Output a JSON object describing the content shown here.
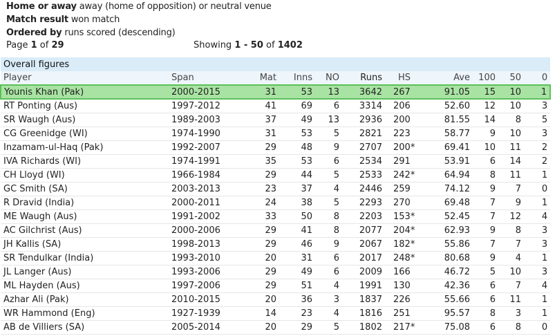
{
  "filters": [
    {
      "label": "Home or away",
      "value": "away (home of opposition) or neutral venue"
    },
    {
      "label": "Match result",
      "value": "won match"
    },
    {
      "label": "Ordered by",
      "value": "runs scored (descending)"
    }
  ],
  "paging": {
    "page_prefix": "Page ",
    "page_current": "1",
    "page_mid": " of ",
    "page_total": "29",
    "showing_prefix": "Showing ",
    "showing_range": "1 - 50",
    "showing_mid": " of ",
    "showing_total": "1402"
  },
  "table": {
    "caption": "Overall figures",
    "headers": [
      "Player",
      "Span",
      "Mat",
      "Inns",
      "NO",
      "Runs",
      "HS",
      "Ave",
      "100",
      "50",
      "0"
    ],
    "rows": [
      [
        "Younis Khan (Pak)",
        "2000-2015",
        "31",
        "53",
        "13",
        "3642",
        "267",
        "91.05",
        "15",
        "10",
        "1"
      ],
      [
        "RT Ponting (Aus)",
        "1997-2012",
        "41",
        "69",
        "6",
        "3314",
        "206",
        "52.60",
        "12",
        "10",
        "3"
      ],
      [
        "SR Waugh (Aus)",
        "1989-2003",
        "37",
        "49",
        "13",
        "2936",
        "200",
        "81.55",
        "14",
        "8",
        "5"
      ],
      [
        "CG Greenidge (WI)",
        "1974-1990",
        "31",
        "53",
        "5",
        "2821",
        "223",
        "58.77",
        "9",
        "10",
        "3"
      ],
      [
        "Inzamam-ul-Haq (Pak)",
        "1992-2007",
        "29",
        "48",
        "9",
        "2707",
        "200*",
        "69.41",
        "10",
        "11",
        "2"
      ],
      [
        "IVA Richards (WI)",
        "1974-1991",
        "35",
        "53",
        "6",
        "2534",
        "291",
        "53.91",
        "6",
        "14",
        "2"
      ],
      [
        "CH Lloyd (WI)",
        "1966-1984",
        "29",
        "44",
        "5",
        "2533",
        "242*",
        "64.94",
        "8",
        "11",
        "1"
      ],
      [
        "GC Smith (SA)",
        "2003-2013",
        "23",
        "37",
        "4",
        "2446",
        "259",
        "74.12",
        "9",
        "7",
        "0"
      ],
      [
        "R Dravid (India)",
        "2000-2011",
        "24",
        "38",
        "5",
        "2293",
        "270",
        "69.48",
        "7",
        "9",
        "1"
      ],
      [
        "ME Waugh (Aus)",
        "1991-2002",
        "33",
        "50",
        "8",
        "2203",
        "153*",
        "52.45",
        "7",
        "12",
        "4"
      ],
      [
        "AC Gilchrist (Aus)",
        "2000-2006",
        "29",
        "41",
        "8",
        "2077",
        "204*",
        "62.93",
        "9",
        "8",
        "3"
      ],
      [
        "JH Kallis (SA)",
        "1998-2013",
        "29",
        "46",
        "9",
        "2067",
        "182*",
        "55.86",
        "7",
        "7",
        "3"
      ],
      [
        "SR Tendulkar (India)",
        "1993-2010",
        "20",
        "31",
        "6",
        "2017",
        "248*",
        "80.68",
        "9",
        "4",
        "1"
      ],
      [
        "JL Langer (Aus)",
        "1993-2006",
        "29",
        "49",
        "6",
        "2009",
        "166",
        "46.72",
        "5",
        "10",
        "3"
      ],
      [
        "ML Hayden (Aus)",
        "1997-2006",
        "29",
        "51",
        "4",
        "1991",
        "130",
        "42.36",
        "6",
        "7",
        "4"
      ],
      [
        "Azhar Ali (Pak)",
        "2010-2015",
        "20",
        "36",
        "3",
        "1837",
        "226",
        "55.66",
        "6",
        "11",
        "1"
      ],
      [
        "WR Hammond (Eng)",
        "1927-1939",
        "14",
        "23",
        "4",
        "1816",
        "251",
        "95.57",
        "8",
        "3",
        "1"
      ],
      [
        "AB de Villiers (SA)",
        "2005-2014",
        "20",
        "29",
        "5",
        "1802",
        "217*",
        "75.08",
        "6",
        "8",
        "0"
      ]
    ],
    "highlighted_row": 0,
    "colors": {
      "caption_bg": "#d9ecf8",
      "header_bg": "#eef5fb",
      "highlight_bg": "#a9e3a3",
      "highlight_border": "#5cc05a"
    }
  }
}
